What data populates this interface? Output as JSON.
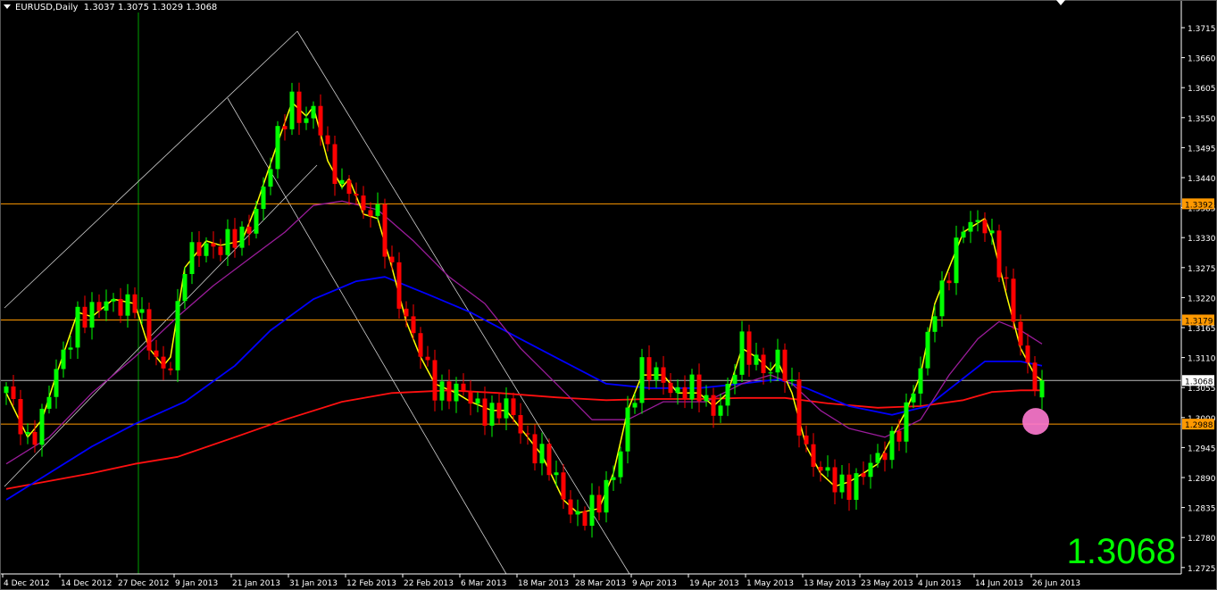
{
  "header": {
    "symbol_timeframe": "EURUSD,Daily",
    "ohlc": "1.3037 1.3075 1.3029 1.3068"
  },
  "big_price": "1.3068",
  "colors": {
    "up": "#00ff00",
    "down": "#ff0000",
    "ma_fast": "#ffff00",
    "ma_purple": "#9b1c9b",
    "ma_blue": "#0000ff",
    "ma_red": "#ff1010",
    "level": "#ff9900",
    "vline": "#00a000",
    "marker": "#ff7ad0"
  },
  "chart_data": {
    "type": "candlestick",
    "symbol": "EURUSD",
    "timeframe": "Daily",
    "ylim": [
      1.27,
      1.374
    ],
    "y_ticks": [
      "1.3715",
      "1.3660",
      "1.3605",
      "1.3550",
      "1.3495",
      "1.3440",
      "1.3385",
      "1.3330",
      "1.3275",
      "1.3220",
      "1.3165",
      "1.3110",
      "1.3055",
      "1.3000",
      "1.2945",
      "1.2890",
      "1.2835",
      "1.2780",
      "1.2725"
    ],
    "x_ticks": [
      {
        "bar": 0,
        "label": "4 Dec 2012"
      },
      {
        "bar": 8,
        "label": "14 Dec 2012"
      },
      {
        "bar": 16,
        "label": "27 Dec 2012"
      },
      {
        "bar": 24,
        "label": "9 Jan 2013"
      },
      {
        "bar": 32,
        "label": "21 Jan 2013"
      },
      {
        "bar": 40,
        "label": "31 Jan 2013"
      },
      {
        "bar": 48,
        "label": "12 Feb 2013"
      },
      {
        "bar": 56,
        "label": "22 Feb 2013"
      },
      {
        "bar": 64,
        "label": "6 Mar 2013"
      },
      {
        "bar": 72,
        "label": "18 Mar 2013"
      },
      {
        "bar": 80,
        "label": "28 Mar 2013"
      },
      {
        "bar": 88,
        "label": "9 Apr 2013"
      },
      {
        "bar": 96,
        "label": "19 Apr 2013"
      },
      {
        "bar": 104,
        "label": "1 May 2013"
      },
      {
        "bar": 112,
        "label": "13 May 2013"
      },
      {
        "bar": 120,
        "label": "23 May 2013"
      },
      {
        "bar": 128,
        "label": "4 Jun 2013"
      },
      {
        "bar": 136,
        "label": "14 Jun 2013"
      },
      {
        "bar": 144,
        "label": "26 Jun 2013"
      }
    ],
    "bar_count": 146,
    "close_path": [
      [
        0,
        1.3045
      ],
      [
        3,
        1.2964
      ],
      [
        5,
        1.2996
      ],
      [
        7,
        1.3078
      ],
      [
        10,
        1.3193
      ],
      [
        12,
        1.3185
      ],
      [
        15,
        1.3217
      ],
      [
        18,
        1.3209
      ],
      [
        20,
        1.3127
      ],
      [
        22,
        1.3095
      ],
      [
        23,
        1.3111
      ],
      [
        25,
        1.3275
      ],
      [
        28,
        1.3324
      ],
      [
        30,
        1.3316
      ],
      [
        33,
        1.3324
      ],
      [
        35,
        1.3389
      ],
      [
        38,
        1.3504
      ],
      [
        40,
        1.3578
      ],
      [
        42,
        1.3553
      ],
      [
        43,
        1.357
      ],
      [
        45,
        1.3471
      ],
      [
        47,
        1.3422
      ],
      [
        48,
        1.3438
      ],
      [
        50,
        1.3373
      ],
      [
        52,
        1.3365
      ],
      [
        54,
        1.3275
      ],
      [
        56,
        1.3176
      ],
      [
        58,
        1.3111
      ],
      [
        60,
        1.3062
      ],
      [
        63,
        1.3045
      ],
      [
        65,
        1.3029
      ],
      [
        68,
        1.3013
      ],
      [
        70,
        1.3013
      ],
      [
        73,
        1.2964
      ],
      [
        75,
        1.2931
      ],
      [
        78,
        1.2849
      ],
      [
        80,
        1.2825
      ],
      [
        83,
        1.2833
      ],
      [
        85,
        1.2898
      ],
      [
        87,
        1.3013
      ],
      [
        89,
        1.3078
      ],
      [
        92,
        1.3078
      ],
      [
        94,
        1.3045
      ],
      [
        97,
        1.3045
      ],
      [
        99,
        1.3021
      ],
      [
        101,
        1.3045
      ],
      [
        103,
        1.3127
      ],
      [
        105,
        1.3111
      ],
      [
        107,
        1.3086
      ],
      [
        108,
        1.3103
      ],
      [
        110,
        1.3045
      ],
      [
        112,
        1.2947
      ],
      [
        114,
        1.2898
      ],
      [
        116,
        1.2874
      ],
      [
        118,
        1.2882
      ],
      [
        120,
        1.2898
      ],
      [
        122,
        1.2915
      ],
      [
        124,
        1.2964
      ],
      [
        126,
        1.3013
      ],
      [
        128,
        1.3078
      ],
      [
        130,
        1.3209
      ],
      [
        132,
        1.3275
      ],
      [
        134,
        1.334
      ],
      [
        137,
        1.3365
      ],
      [
        138,
        1.3332
      ],
      [
        140,
        1.3226
      ],
      [
        142,
        1.3127
      ],
      [
        144,
        1.3078
      ],
      [
        145,
        1.3068
      ]
    ],
    "ma_purple": [
      [
        0,
        1.2915
      ],
      [
        6,
        1.2964
      ],
      [
        12,
        1.3045
      ],
      [
        18,
        1.3111
      ],
      [
        24,
        1.3185
      ],
      [
        29,
        1.3242
      ],
      [
        34,
        1.3291
      ],
      [
        39,
        1.334
      ],
      [
        43,
        1.3389
      ],
      [
        47,
        1.3397
      ],
      [
        52,
        1.3381
      ],
      [
        57,
        1.3324
      ],
      [
        62,
        1.3258
      ],
      [
        67,
        1.3209
      ],
      [
        72,
        1.3127
      ],
      [
        77,
        1.3062
      ],
      [
        82,
        1.2996
      ],
      [
        87,
        1.2996
      ],
      [
        92,
        1.3029
      ],
      [
        98,
        1.3029
      ],
      [
        103,
        1.3062
      ],
      [
        107,
        1.3078
      ],
      [
        110,
        1.3062
      ],
      [
        114,
        1.3013
      ],
      [
        118,
        1.298
      ],
      [
        123,
        1.2964
      ],
      [
        128,
        1.2996
      ],
      [
        132,
        1.3078
      ],
      [
        136,
        1.3144
      ],
      [
        139,
        1.3176
      ],
      [
        142,
        1.316
      ],
      [
        145,
        1.3135
      ]
    ],
    "ma_blue": [
      [
        0,
        1.2849
      ],
      [
        6,
        1.2898
      ],
      [
        12,
        1.2947
      ],
      [
        18,
        1.2988
      ],
      [
        25,
        1.3029
      ],
      [
        32,
        1.3095
      ],
      [
        37,
        1.316
      ],
      [
        43,
        1.3217
      ],
      [
        49,
        1.325
      ],
      [
        53,
        1.3258
      ],
      [
        59,
        1.3226
      ],
      [
        65,
        1.3193
      ],
      [
        72,
        1.3144
      ],
      [
        78,
        1.3103
      ],
      [
        84,
        1.3062
      ],
      [
        90,
        1.3054
      ],
      [
        97,
        1.3054
      ],
      [
        103,
        1.3062
      ],
      [
        108,
        1.307
      ],
      [
        112,
        1.3054
      ],
      [
        118,
        1.3021
      ],
      [
        124,
        1.3005
      ],
      [
        129,
        1.3021
      ],
      [
        133,
        1.3062
      ],
      [
        137,
        1.3103
      ],
      [
        142,
        1.3103
      ],
      [
        145,
        1.3095
      ]
    ],
    "ma_red": [
      [
        0,
        1.2869
      ],
      [
        12,
        1.2898
      ],
      [
        18,
        1.2915
      ],
      [
        24,
        1.2928
      ],
      [
        32,
        1.2964
      ],
      [
        39,
        1.2996
      ],
      [
        47,
        1.3029
      ],
      [
        54,
        1.3045
      ],
      [
        62,
        1.305
      ],
      [
        69,
        1.3045
      ],
      [
        77,
        1.3037
      ],
      [
        84,
        1.3032
      ],
      [
        90,
        1.3034
      ],
      [
        97,
        1.3034
      ],
      [
        103,
        1.3036
      ],
      [
        109,
        1.3036
      ],
      [
        115,
        1.3026
      ],
      [
        122,
        1.3018
      ],
      [
        128,
        1.3021
      ],
      [
        134,
        1.3032
      ],
      [
        138,
        1.3047
      ],
      [
        142,
        1.305
      ],
      [
        145,
        1.305
      ]
    ],
    "levels": [
      {
        "price": 1.3392,
        "label": "1.3392",
        "kind": "level"
      },
      {
        "price": 1.3179,
        "label": "1.3179",
        "kind": "level"
      },
      {
        "price": 1.3068,
        "label": "1.3068",
        "kind": "bid"
      },
      {
        "price": 1.2988,
        "label": "1.2988",
        "kind": "level"
      }
    ],
    "vertical_line_bar": 18.5,
    "marker": {
      "bar": 144,
      "price": 1.2993
    }
  }
}
